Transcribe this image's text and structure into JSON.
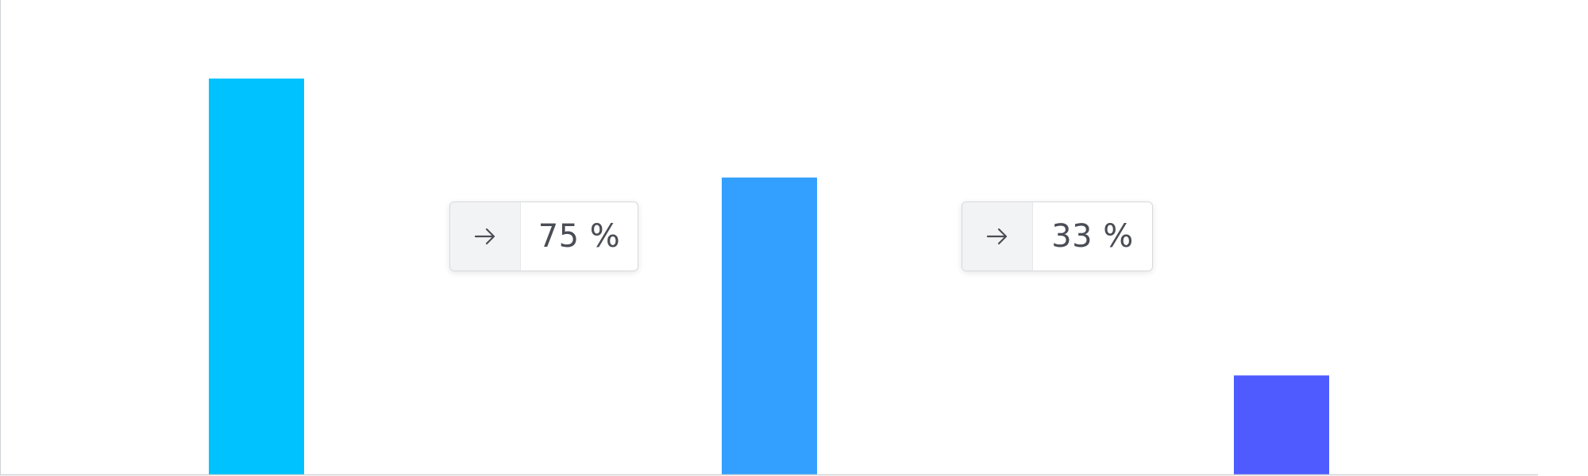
{
  "chart_data": {
    "type": "bar",
    "categories": [
      "",
      "",
      ""
    ],
    "values": [
      100,
      75,
      25
    ],
    "colors": [
      "#00c2ff",
      "#33a0ff",
      "#4f5bff"
    ],
    "ylim": [
      0,
      100
    ],
    "grid": false,
    "title": "",
    "xlabel": "",
    "ylabel": "",
    "annotations": [
      {
        "icon": "arrow-right-icon",
        "text": "75 %"
      },
      {
        "icon": "arrow-right-icon",
        "text": "33 %"
      }
    ]
  }
}
